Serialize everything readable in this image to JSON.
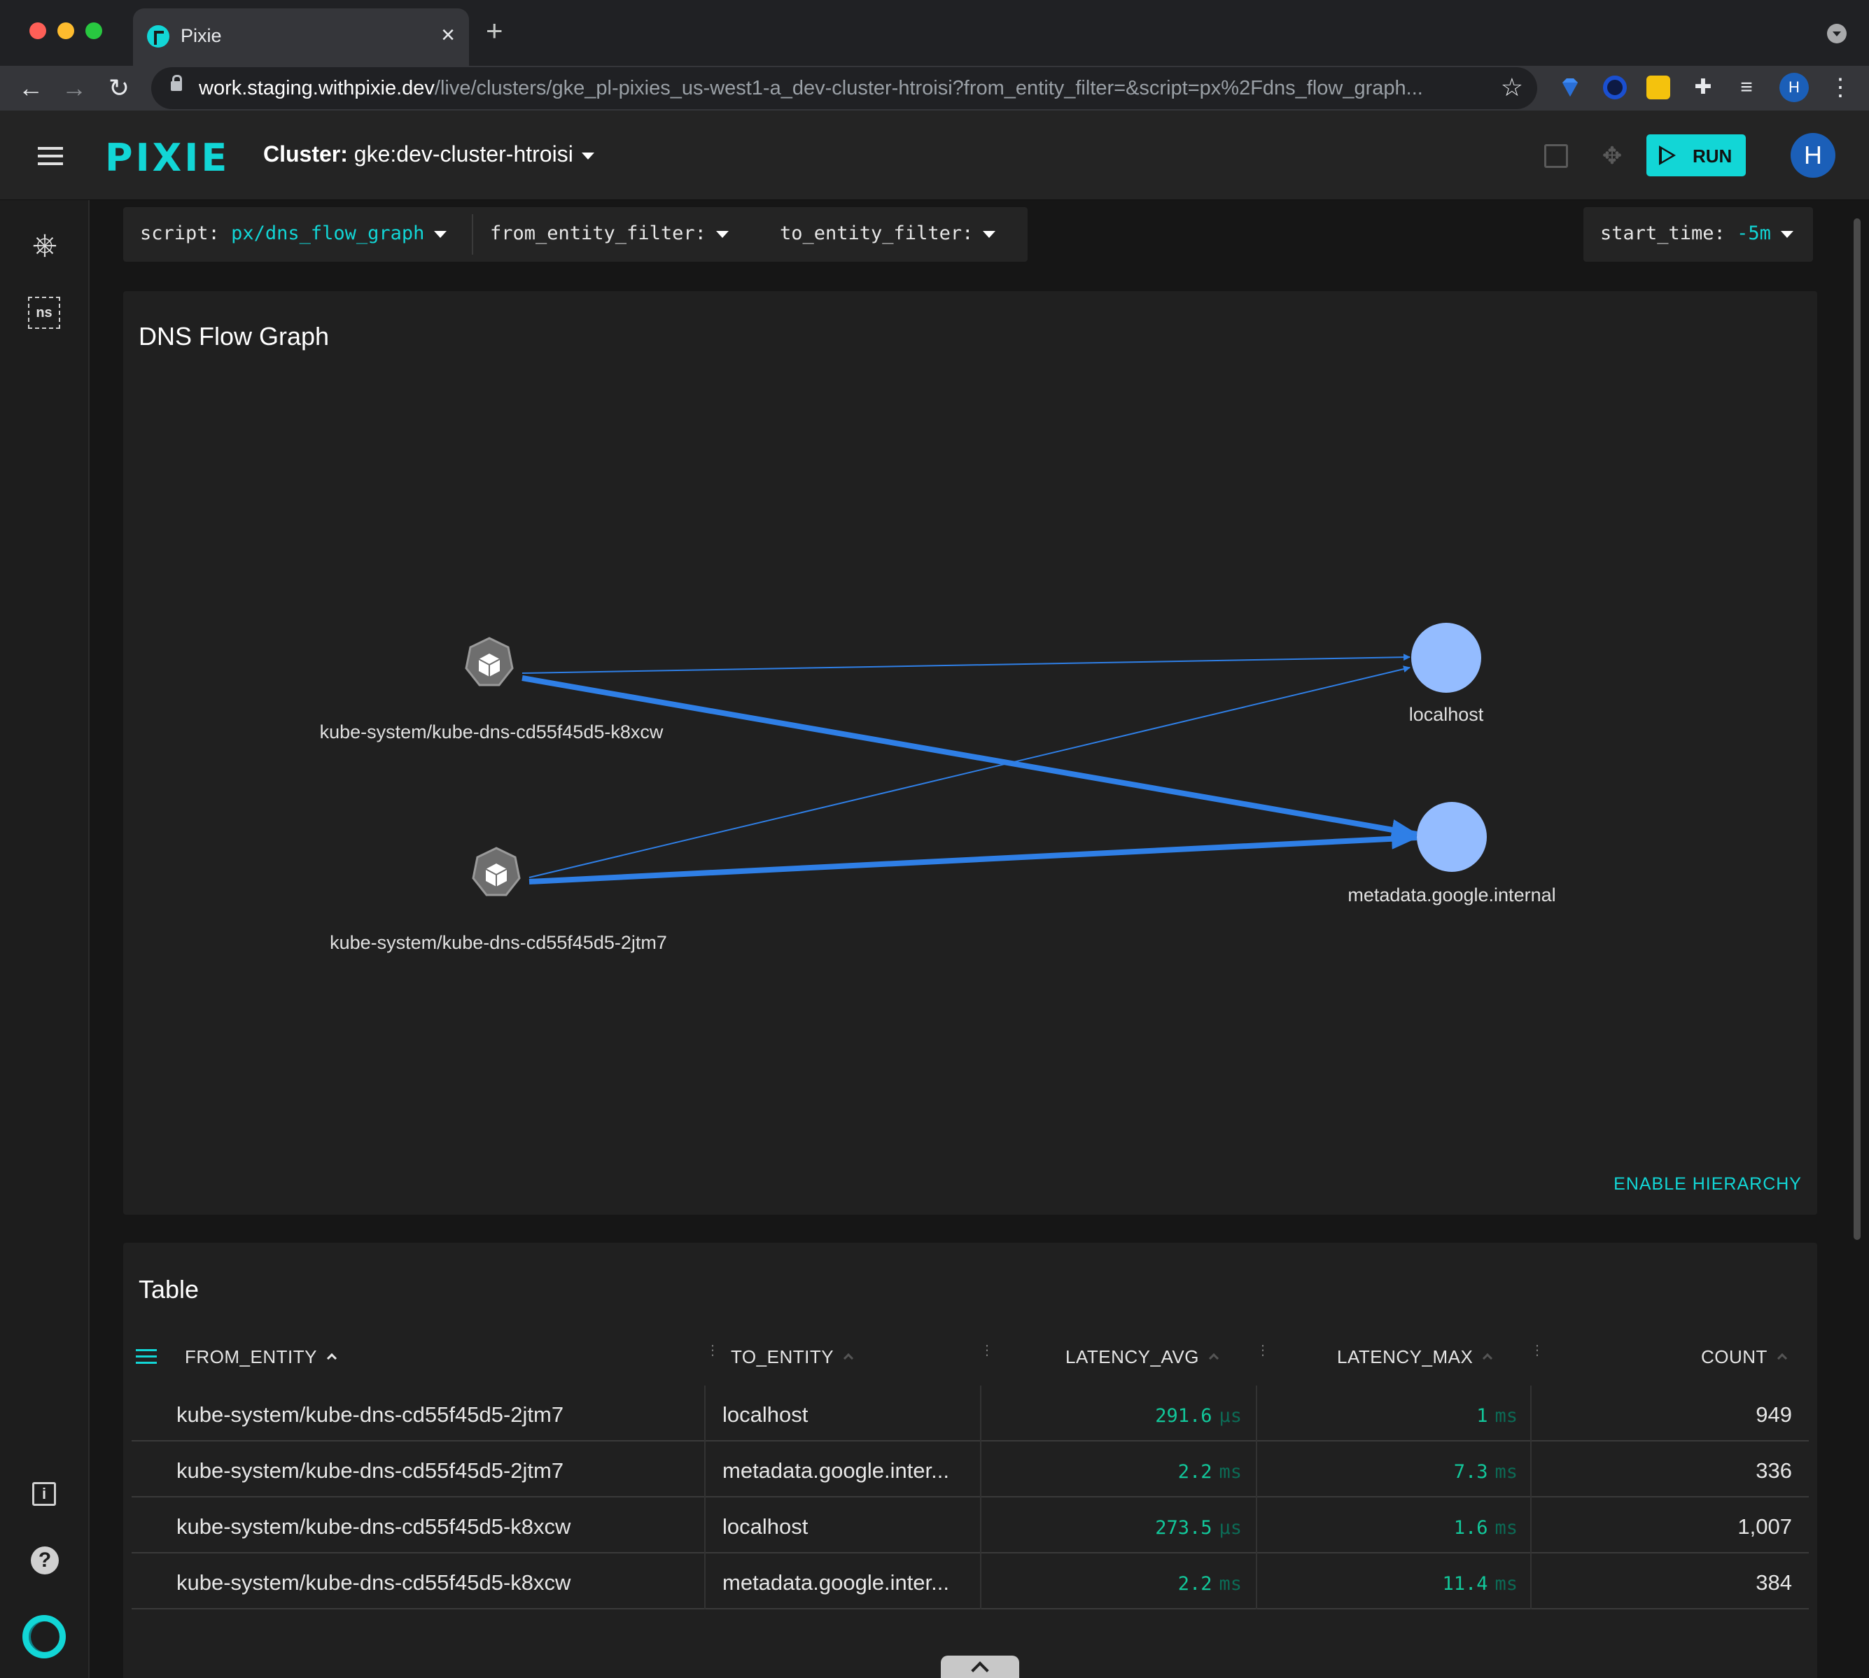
{
  "browser": {
    "tab_title": "Pixie",
    "tab_close": "×",
    "new_tab": "+",
    "url_host": "work.staging.withpixie.dev",
    "url_path": "/live/clusters/gke_pl-pixies_us-west1-a_dev-cluster-htroisi?from_entity_filter=&script=px%2Fdns_flow_graph...",
    "profile_initial": "H"
  },
  "header": {
    "logo": "PIXIE",
    "cluster_label": "Cluster:",
    "cluster_name": "gke:dev-cluster-htroisi",
    "run_label": "RUN",
    "avatar_initial": "H"
  },
  "sidebar": {
    "ns_label": "ns",
    "info_label": "i",
    "help_label": "?"
  },
  "variables": {
    "script_key": "script:",
    "script_value": "px/dns_flow_graph",
    "from_key": "from_entity_filter:",
    "to_key": "to_entity_filter:",
    "start_key": "start_time:",
    "start_value": "-5m"
  },
  "graph": {
    "title": "DNS Flow Graph",
    "enable_hierarchy": "ENABLE HIERARCHY",
    "nodes": {
      "pod_a": "kube-system/kube-dns-cd55f45d5-k8xcw",
      "pod_b": "kube-system/kube-dns-cd55f45d5-2jtm7",
      "svc_localhost": "localhost",
      "svc_metadata": "metadata.google.internal"
    }
  },
  "table": {
    "title": "Table",
    "columns": [
      "FROM_ENTITY",
      "TO_ENTITY",
      "LATENCY_AVG",
      "LATENCY_MAX",
      "COUNT"
    ],
    "rows": [
      {
        "from": "kube-system/kube-dns-cd55f45d5-2jtm7",
        "to": "localhost",
        "avg": "291.6",
        "avg_unit": "µs",
        "max": "1",
        "max_unit": "ms",
        "count": "949"
      },
      {
        "from": "kube-system/kube-dns-cd55f45d5-2jtm7",
        "to": "metadata.google.inter...",
        "avg": "2.2",
        "avg_unit": "ms",
        "max": "7.3",
        "max_unit": "ms",
        "count": "336"
      },
      {
        "from": "kube-system/kube-dns-cd55f45d5-k8xcw",
        "to": "localhost",
        "avg": "273.5",
        "avg_unit": "µs",
        "max": "1.6",
        "max_unit": "ms",
        "count": "1,007"
      },
      {
        "from": "kube-system/kube-dns-cd55f45d5-k8xcw",
        "to": "metadata.google.inter...",
        "avg": "2.2",
        "avg_unit": "ms",
        "max": "11.4",
        "max_unit": "ms",
        "count": "384"
      }
    ]
  },
  "colors": {
    "accent": "#12d6d6",
    "edge": "#2f7fe6",
    "service_node": "#94bcff",
    "pod_node": "#6e6e6e"
  }
}
